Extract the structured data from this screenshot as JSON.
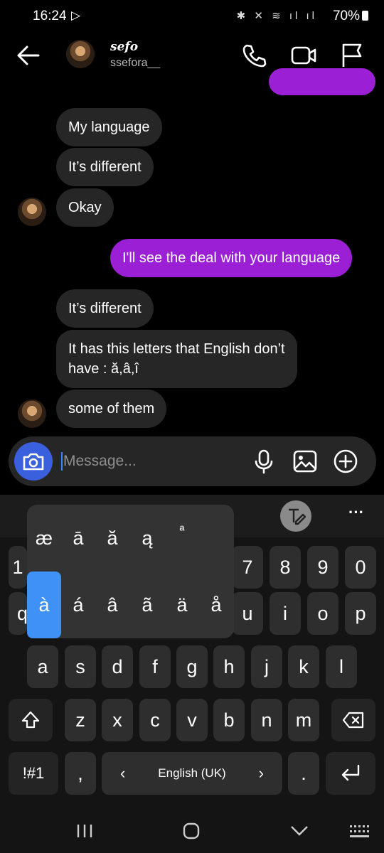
{
  "status": {
    "time": "16:24",
    "battery": "70%"
  },
  "header": {
    "display_name": "sefo",
    "username": "ssefora__"
  },
  "messages": [
    {
      "text": "My language"
    },
    {
      "text": "It’s different"
    },
    {
      "text": "Okay"
    },
    {
      "text": "I'll see the deal with your language"
    },
    {
      "text": "It’s different"
    },
    {
      "text_line1": "It has this letters that English don’t",
      "text_line2": "have : ă,â,î"
    },
    {
      "text": "some of them"
    }
  ],
  "composer": {
    "placeholder": "Message..."
  },
  "keyboard": {
    "numbers": [
      "1",
      "7",
      "8",
      "9",
      "0"
    ],
    "row2": [
      "q",
      "u",
      "i",
      "o",
      "p"
    ],
    "row3": [
      "a",
      "s",
      "d",
      "f",
      "g",
      "h",
      "j",
      "k",
      "l"
    ],
    "row4": [
      "z",
      "x",
      "c",
      "v",
      "b",
      "n",
      "m"
    ],
    "sym": "!#1",
    "comma": ",",
    "space": "English (UK)",
    "space_left": "‹",
    "space_right": "›",
    "period": ".",
    "more": "···",
    "popup_row1": [
      "æ",
      "ā",
      "ă",
      "ą",
      "ª"
    ],
    "popup_row2": [
      "à",
      "á",
      "â",
      "ã",
      "ä",
      "å"
    ]
  }
}
